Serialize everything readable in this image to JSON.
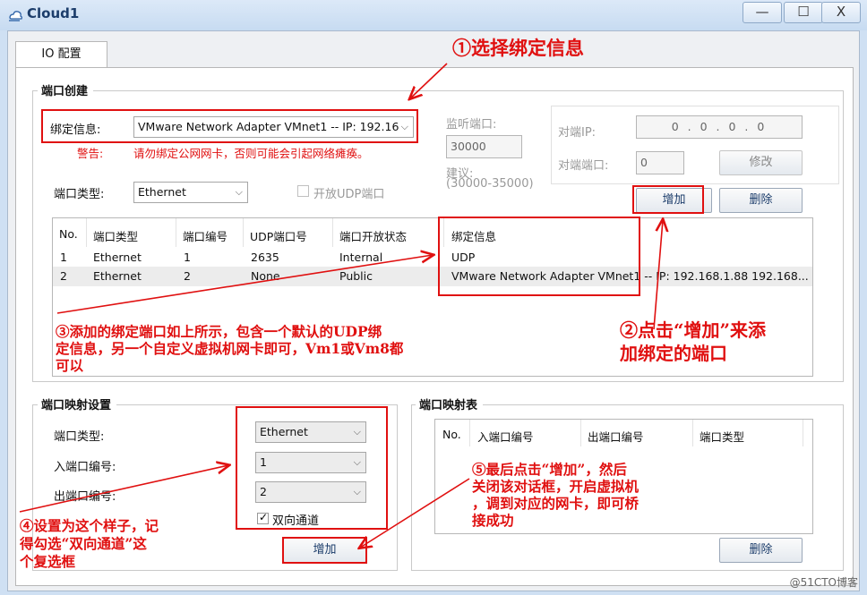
{
  "window": {
    "title": "Cloud1",
    "controls": {
      "minimize": "—",
      "maximize": "☐",
      "close": "X"
    }
  },
  "tab": {
    "label": "IO 配置"
  },
  "port_create": {
    "title": "端口创建",
    "binding_label": "绑定信息:",
    "binding_value": "VMware Network Adapter VMnet1 -- IP: 192.16",
    "warning_label": "警告:",
    "warning_text": "请勿绑定公网网卡，否则可能会引起网络瘫痪。",
    "port_type_label": "端口类型:",
    "port_type_value": "Ethernet",
    "udp_checkbox_label": "开放UDP端口",
    "listen_port_label": "监听端口:",
    "listen_port_value": "30000",
    "suggest_label": "建议:",
    "suggest_range": "(30000-35000)",
    "peer_ip_label": "对端IP:",
    "peer_ip_value": "0 . 0 . 0 . 0",
    "peer_port_label": "对端端口:",
    "peer_port_value": "0",
    "modify_button": "修改",
    "add_button": "增加",
    "delete_button": "删除",
    "table": {
      "headers": [
        "No.",
        "端口类型",
        "端口编号",
        "UDP端口号",
        "端口开放状态",
        "绑定信息"
      ],
      "rows": [
        [
          "1",
          "Ethernet",
          "1",
          "2635",
          "Internal",
          "UDP"
        ],
        [
          "2",
          "Ethernet",
          "2",
          "None",
          "Public",
          "VMware Network Adapter VMnet1 -- IP: 192.168.1.88 192.168..."
        ]
      ]
    }
  },
  "port_mapping_settings": {
    "title": "端口映射设置",
    "port_type_label": "端口类型:",
    "port_type_value": "Ethernet",
    "in_port_label": "入端口编号:",
    "in_port_value": "1",
    "out_port_label": "出端口编号:",
    "out_port_value": "2",
    "bidirectional_label": "双向通道",
    "add_button": "增加"
  },
  "port_mapping_table": {
    "title": "端口映射表",
    "headers": [
      "No.",
      "入端口编号",
      "出端口编号",
      "端口类型"
    ],
    "delete_button": "删除"
  },
  "annotations": {
    "a1": "①选择绑定信息",
    "a2_line1": "②点击“增加”来添",
    "a2_line2": "加绑定的端口",
    "a3_line1": "③添加的绑定端口如上所示，包含一个默认的UDP绑",
    "a3_line2": "定信息，另一个自定义虚拟机网卡即可，Vm1或Vm8都",
    "a3_line3": "可以",
    "a4_line1": "④设置为这个样子，记",
    "a4_line2": "得勾选“双向通道”这",
    "a4_line3": "个复选框",
    "a5_line1": "⑤最后点击“增加”，然后",
    "a5_line2": "关闭该对话框，开启虚拟机",
    "a5_line3": "，调到对应的网卡，即可桥",
    "a5_line4": "接成功"
  },
  "watermark": "@51CTO博客",
  "colors": {
    "annotation": "#e01010",
    "window_bg": "#cfe0f3",
    "title_text": "#1c3d6b"
  }
}
